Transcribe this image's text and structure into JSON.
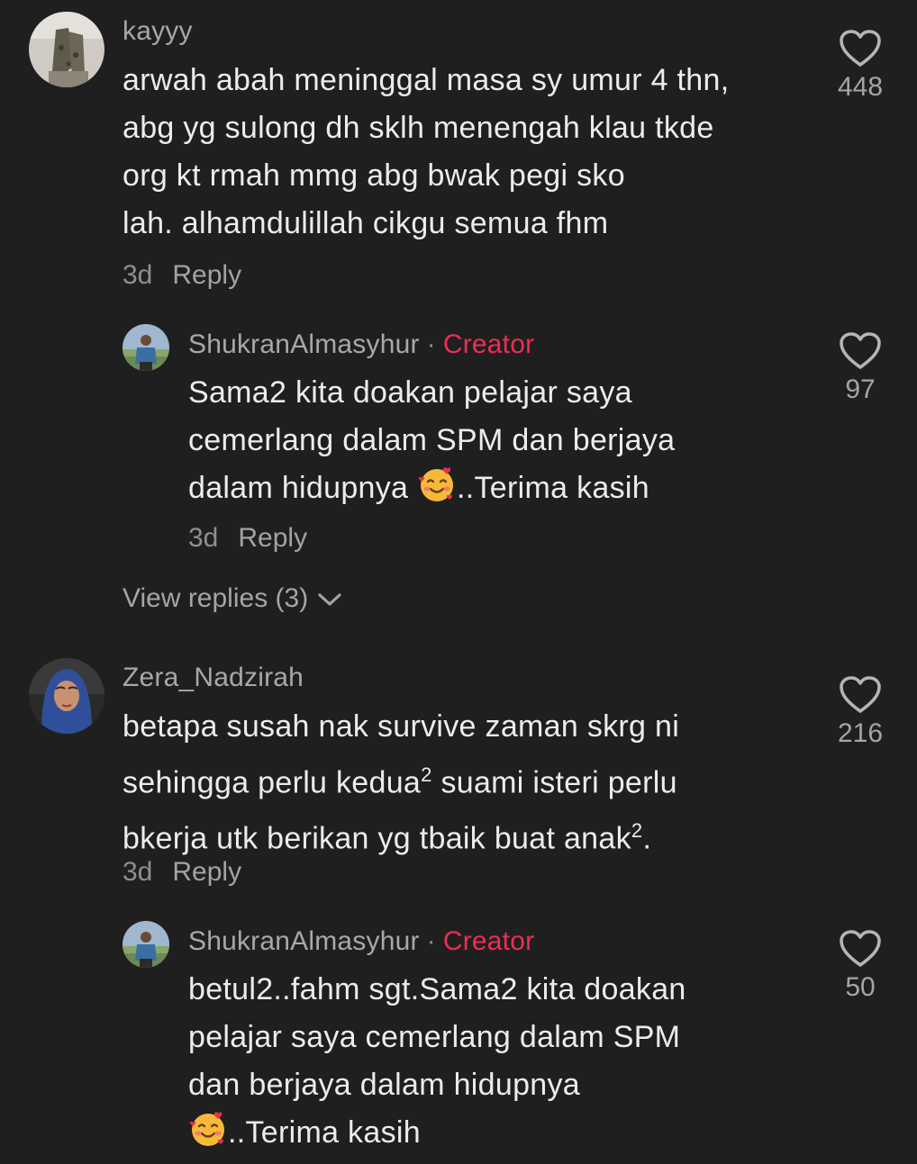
{
  "comments": [
    {
      "username": "kayyy",
      "lines": [
        "arwah abah meninggal masa sy umur 4 thn,",
        "abg yg sulong dh sklh menengah klau tkde",
        "org kt rmah mmg abg bwak pegi sko",
        "lah. alhamdulillah cikgu semua fhm"
      ],
      "time": "3d",
      "reply_label": "Reply",
      "likes": "448"
    },
    {
      "username": "ShukranAlmasyhur",
      "separator": "·",
      "badge": "Creator",
      "lines": [
        "Sama2 kita doakan pelajar saya",
        "cemerlang dalam SPM dan berjaya",
        "dalam hidupnya",
        "..Terima kasih"
      ],
      "time": "3d",
      "reply_label": "Reply",
      "likes": "97"
    },
    {
      "username": "Zera_Nadzirah",
      "lines": [
        "betapa susah nak survive zaman skrg ni",
        "sehingga perlu kedua",
        "suami isteri perlu",
        "bkerja utk berikan yg tbaik buat anak",
        "."
      ],
      "superscript": "2",
      "time": "3d",
      "reply_label": "Reply",
      "likes": "216"
    },
    {
      "username": "ShukranAlmasyhur",
      "separator": "·",
      "badge": "Creator",
      "lines": [
        "betul2..fahm sgt.Sama2 kita doakan",
        "pelajar saya cemerlang dalam SPM",
        "dan berjaya dalam hidupnya",
        "..Terima kasih"
      ],
      "likes": "50"
    }
  ],
  "view_replies": "View replies (3)",
  "icons": {
    "like": "heart-outline-icon",
    "expand": "chevron-down-icon",
    "emoji": "smiling-face-with-hearts-emoji"
  },
  "colors": {
    "background": "#1f1f1f",
    "creator_badge": "#ee2d55",
    "text": "#ececec",
    "muted": "#a5a5a5"
  }
}
